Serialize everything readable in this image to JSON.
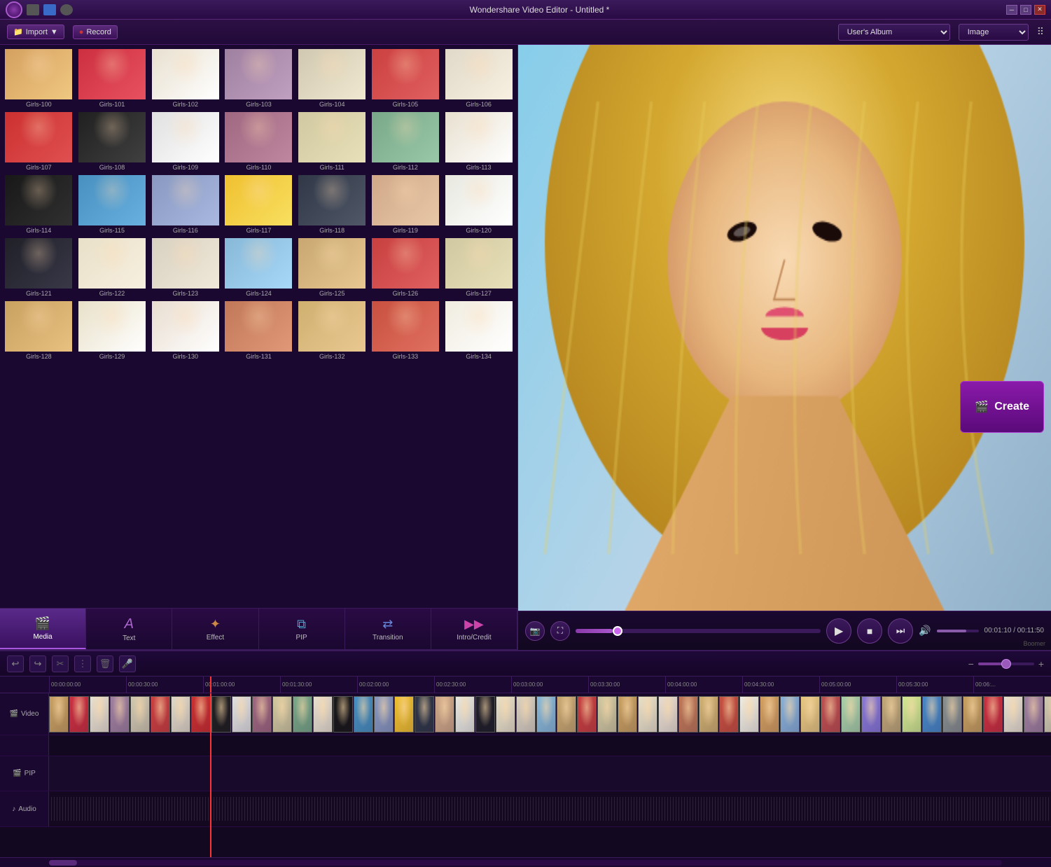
{
  "titleBar": {
    "title": "Wondershare Video Editor - Untitled *",
    "minBtn": "─",
    "maxBtn": "□",
    "closeBtn": "✕"
  },
  "toolbar": {
    "importLabel": "Import",
    "recordLabel": "Record",
    "albumDropdown": "User's Album",
    "typeDropdown": "Image"
  },
  "tabs": [
    {
      "id": "media",
      "label": "Media",
      "icon": "🎬",
      "active": true
    },
    {
      "id": "text",
      "label": "Text",
      "icon": "✦",
      "active": false
    },
    {
      "id": "effect",
      "label": "Effect",
      "icon": "✦",
      "active": false
    },
    {
      "id": "pip",
      "label": "PIP",
      "icon": "✦",
      "active": false
    },
    {
      "id": "transition",
      "label": "Transition",
      "icon": "✦",
      "active": false
    },
    {
      "id": "intro",
      "label": "Intro/Credit",
      "icon": "▶▶",
      "active": false
    }
  ],
  "mediaGrid": {
    "items": [
      {
        "id": "Girls-100",
        "color1": "#d4a060",
        "color2": "#f0c880"
      },
      {
        "id": "Girls-101",
        "color1": "#cc3040",
        "color2": "#e85060"
      },
      {
        "id": "Girls-102",
        "color1": "#e8e0d0",
        "color2": "#ffffff"
      },
      {
        "id": "Girls-103",
        "color1": "#a080a0",
        "color2": "#c0a0c0"
      },
      {
        "id": "Girls-104",
        "color1": "#d0c8b0",
        "color2": "#f0e8d0"
      },
      {
        "id": "Girls-105",
        "color1": "#cc4040",
        "color2": "#e06060"
      },
      {
        "id": "Girls-106",
        "color1": "#e0d8c8",
        "color2": "#f8f0e0"
      },
      {
        "id": "Girls-107",
        "color1": "#cc3030",
        "color2": "#e05050"
      },
      {
        "id": "Girls-108",
        "color1": "#202020",
        "color2": "#404040"
      },
      {
        "id": "Girls-109",
        "color1": "#e0e0e0",
        "color2": "#ffffff"
      },
      {
        "id": "Girls-110",
        "color1": "#a06880",
        "color2": "#c088a0"
      },
      {
        "id": "Girls-111",
        "color1": "#d0c8a0",
        "color2": "#e8e0b8"
      },
      {
        "id": "Girls-112",
        "color1": "#78a888",
        "color2": "#98c8a8"
      },
      {
        "id": "Girls-113",
        "color1": "#e8e0d0",
        "color2": "#ffffff"
      },
      {
        "id": "Girls-114",
        "color1": "#181818",
        "color2": "#303030"
      },
      {
        "id": "Girls-115",
        "color1": "#4890c0",
        "color2": "#68b0e0"
      },
      {
        "id": "Girls-116",
        "color1": "#8898c0",
        "color2": "#a8b8e0"
      },
      {
        "id": "Girls-117",
        "color1": "#f0c030",
        "color2": "#f8e060"
      },
      {
        "id": "Girls-118",
        "color1": "#303848",
        "color2": "#505868"
      },
      {
        "id": "Girls-119",
        "color1": "#d0a888",
        "color2": "#e8c8a8"
      },
      {
        "id": "Girls-120",
        "color1": "#e8e8e0",
        "color2": "#ffffff"
      },
      {
        "id": "Girls-121",
        "color1": "#202028",
        "color2": "#383848"
      },
      {
        "id": "Girls-122",
        "color1": "#e8e0c8",
        "color2": "#f8f0e0"
      },
      {
        "id": "Girls-123",
        "color1": "#d8d0c0",
        "color2": "#f0e8d8"
      },
      {
        "id": "Girls-124",
        "color1": "#88b8d8",
        "color2": "#a8d8f8"
      },
      {
        "id": "Girls-125",
        "color1": "#c8a870",
        "color2": "#e8c890"
      },
      {
        "id": "Girls-126",
        "color1": "#c84040",
        "color2": "#e06060"
      },
      {
        "id": "Girls-127",
        "color1": "#d0c8a0",
        "color2": "#e8e0b8"
      },
      {
        "id": "Girls-128",
        "color1": "#c8a060",
        "color2": "#e8c080"
      },
      {
        "id": "Girls-129",
        "color1": "#e8e0c8",
        "color2": "#ffffff"
      },
      {
        "id": "Girls-130",
        "color1": "#e8ddd0",
        "color2": "#ffffff"
      },
      {
        "id": "Girls-131",
        "color1": "#c07858",
        "color2": "#e09878"
      },
      {
        "id": "Girls-132",
        "color1": "#d0b070",
        "color2": "#e8c890"
      },
      {
        "id": "Girls-133",
        "color1": "#c85040",
        "color2": "#e07060"
      },
      {
        "id": "Girls-134",
        "color1": "#f0ece0",
        "color2": "#ffffff"
      }
    ]
  },
  "preview": {
    "timeDisplay": "00:01:10 / 00:11:50"
  },
  "createBtn": "Create",
  "timeline": {
    "tracks": [
      {
        "id": "video",
        "label": "Video",
        "icon": "🎬"
      },
      {
        "id": "pip",
        "label": "PIP",
        "icon": "🎬"
      },
      {
        "id": "audio",
        "label": "Audio",
        "icon": "♪"
      }
    ],
    "rulerMarks": [
      "00:00:00:00",
      "00:00:30:00",
      "00:01:00:00",
      "00:01:30:00",
      "00:02:00:00",
      "00:02:30:00",
      "00:03:00:00",
      "00:03:30:00",
      "00:04:00:00",
      "00:04:30:00",
      "00:05:00:00",
      "00:05:30:00",
      "00:06:..."
    ]
  },
  "timelineToolbar": {
    "undoLabel": "↩",
    "redoLabel": "↪",
    "cutLabel": "✂",
    "splitLabel": "⋮",
    "deleteLabel": "🗑",
    "audioLabel": "🎤",
    "zoomInLabel": "+",
    "zoomOutLabel": "−"
  },
  "watermark": "Boomer"
}
